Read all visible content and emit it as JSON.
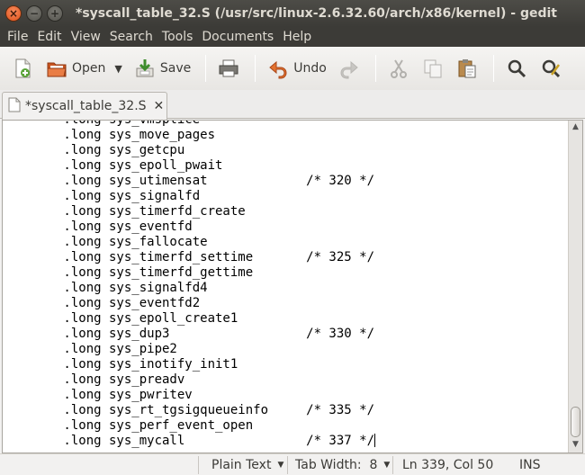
{
  "window": {
    "title": "*syscall_table_32.S (/usr/src/linux-2.6.32.60/arch/x86/kernel) - gedit",
    "close_glyph": "×",
    "min_glyph": "−",
    "max_glyph": "+"
  },
  "menu": [
    "File",
    "Edit",
    "View",
    "Search",
    "Tools",
    "Documents",
    "Help"
  ],
  "toolbar": {
    "open_label": "Open",
    "save_label": "Save",
    "undo_label": "Undo"
  },
  "tab": {
    "label": "*syscall_table_32.S",
    "close_glyph": "✕"
  },
  "editor": {
    "lines": [
      "\t.long sys_vmsplice",
      "\t.long sys_move_pages",
      "\t.long sys_getcpu",
      "\t.long sys_epoll_pwait",
      "\t.long sys_utimensat\t\t/* 320 */",
      "\t.long sys_signalfd",
      "\t.long sys_timerfd_create",
      "\t.long sys_eventfd",
      "\t.long sys_fallocate",
      "\t.long sys_timerfd_settime\t/* 325 */",
      "\t.long sys_timerfd_gettime",
      "\t.long sys_signalfd4",
      "\t.long sys_eventfd2",
      "\t.long sys_epoll_create1",
      "\t.long sys_dup3\t\t\t/* 330 */",
      "\t.long sys_pipe2",
      "\t.long sys_inotify_init1",
      "\t.long sys_preadv",
      "\t.long sys_pwritev",
      "\t.long sys_rt_tgsigqueueinfo\t/* 335 */",
      "\t.long sys_perf_event_open",
      "\t.long sys_mycall\t\t/* 337 */"
    ]
  },
  "status": {
    "language": "Plain Text",
    "tab_width": "Tab Width:  8",
    "position": "Ln 339, Col 50",
    "mode": "INS"
  },
  "colors": {
    "title_bg": "#3c3b37",
    "close_button": "#e0531c",
    "editor_bg": "#ffffff"
  }
}
